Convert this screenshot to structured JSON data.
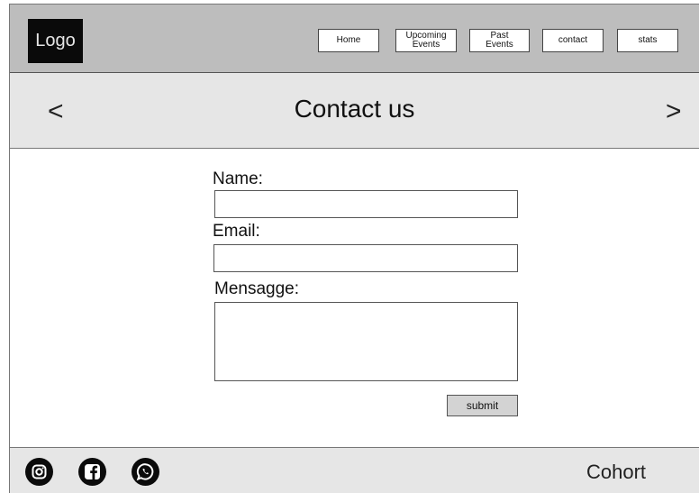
{
  "header": {
    "logo": "Logo",
    "nav": [
      {
        "label": "Home"
      },
      {
        "label": "Upcoming\nEvents"
      },
      {
        "label": "Past\nEvents"
      },
      {
        "label": "contact"
      },
      {
        "label": "stats"
      }
    ]
  },
  "banner": {
    "title": "Contact us",
    "prev": "<",
    "next": ">"
  },
  "form": {
    "name_label": "Name:",
    "name_value": "",
    "email_label": "Email:",
    "email_value": "",
    "message_label": "Mensagge:",
    "message_value": "",
    "submit_label": "submit"
  },
  "footer": {
    "icons": [
      "instagram-icon",
      "facebook-icon",
      "whatsapp-icon"
    ],
    "brand": "Cohort"
  }
}
